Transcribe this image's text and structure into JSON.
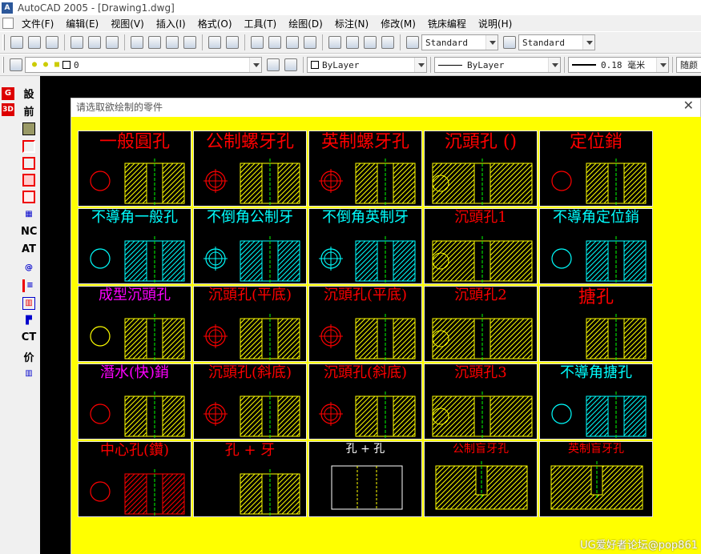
{
  "window": {
    "title": "AutoCAD 2005 - [Drawing1.dwg]"
  },
  "menu": [
    "文件(F)",
    "编辑(E)",
    "视图(V)",
    "插入(I)",
    "格式(O)",
    "工具(T)",
    "绘图(D)",
    "标注(N)",
    "修改(M)",
    "铣床编程",
    "说明(H)"
  ],
  "toolbar": {
    "text_style": "Standard",
    "dim_style": "Standard",
    "layer": "0",
    "color": "ByLayer",
    "linetype": "ByLayer",
    "lineweight": "0.18 毫米",
    "plotstyle": "随颜"
  },
  "left_toolbar": {
    "labels": [
      "設",
      "前",
      "NC",
      "AT",
      "CT",
      "价"
    ],
    "badges": [
      "G",
      "3D"
    ]
  },
  "dialog": {
    "title": "请选取欲绘制的零件",
    "close_symbol": "✕",
    "parts": [
      {
        "id": "p1",
        "label": "一般圓孔",
        "label_color": "#ff0000",
        "body_color": "#ffff00"
      },
      {
        "id": "p2",
        "label": "公制螺牙孔",
        "label_color": "#ff0000",
        "body_color": "#ffff00"
      },
      {
        "id": "p3",
        "label": "英制螺牙孔",
        "label_color": "#ff0000",
        "body_color": "#ffff00"
      },
      {
        "id": "p4",
        "label": "沉頭孔 ()",
        "label_color": "#ff0000",
        "body_color": "#ffff00"
      },
      {
        "id": "p5",
        "label": "定位銷",
        "label_color": "#ff0000",
        "body_color": "#ffff00"
      },
      {
        "id": "p6",
        "label": "不導角一般孔",
        "label_color": "#00ffff",
        "body_color": "#00ffff"
      },
      {
        "id": "p7",
        "label": "不倒角公制牙",
        "label_color": "#00ffff",
        "body_color": "#00ffff"
      },
      {
        "id": "p8",
        "label": "不倒角英制牙",
        "label_color": "#00ffff",
        "body_color": "#00ffff"
      },
      {
        "id": "p9",
        "label": "沉頭孔1",
        "label_color": "#ff0000",
        "body_color": "#ffff00"
      },
      {
        "id": "p10",
        "label": "不導角定位銷",
        "label_color": "#00ffff",
        "body_color": "#00ffff"
      },
      {
        "id": "p11",
        "label": "成型沉頭孔",
        "label_color": "#ff00ff",
        "body_color": "#ffff00"
      },
      {
        "id": "p12",
        "label": "沉頭孔(平底)",
        "label_color": "#ff0000",
        "body_color": "#ffff00"
      },
      {
        "id": "p13",
        "label": "沉頭孔(平底)",
        "label_color": "#ff0000",
        "body_color": "#ffff00"
      },
      {
        "id": "p14",
        "label": "沉頭孔2",
        "label_color": "#ff0000",
        "body_color": "#ffff00"
      },
      {
        "id": "p15",
        "label": "搪孔",
        "label_color": "#ff0000",
        "body_color": "#ffff00"
      },
      {
        "id": "p16",
        "label": "潛水(快)銷",
        "label_color": "#ff00ff",
        "body_color": "#ffff00"
      },
      {
        "id": "p17",
        "label": "沉頭孔(斜底)",
        "label_color": "#ff0000",
        "body_color": "#ffff00"
      },
      {
        "id": "p18",
        "label": "沉頭孔(斜底)",
        "label_color": "#ff0000",
        "body_color": "#ffff00"
      },
      {
        "id": "p19",
        "label": "沉頭孔3",
        "label_color": "#ff0000",
        "body_color": "#ffff00"
      },
      {
        "id": "p20",
        "label": "不導角搪孔",
        "label_color": "#00ffff",
        "body_color": "#00ffff"
      },
      {
        "id": "p21",
        "label": "中心孔(鑽)",
        "label_color": "#ff0000",
        "body_color": "#ff0000"
      },
      {
        "id": "p22",
        "label": "孔 + 牙",
        "label_color": "#ff0000",
        "body_color": "#ffff00"
      },
      {
        "id": "p23",
        "label": "孔 + 孔",
        "label_color": "#ffffff",
        "body_color": "#ffff00"
      },
      {
        "id": "p24",
        "label": "公制盲牙孔",
        "label_color": "#ff0000",
        "body_color": "#ffff00"
      },
      {
        "id": "p25",
        "label": "英制盲牙孔",
        "label_color": "#ff0000",
        "body_color": "#ffff00"
      }
    ]
  },
  "watermark": "UG爱好者论坛@pop861"
}
